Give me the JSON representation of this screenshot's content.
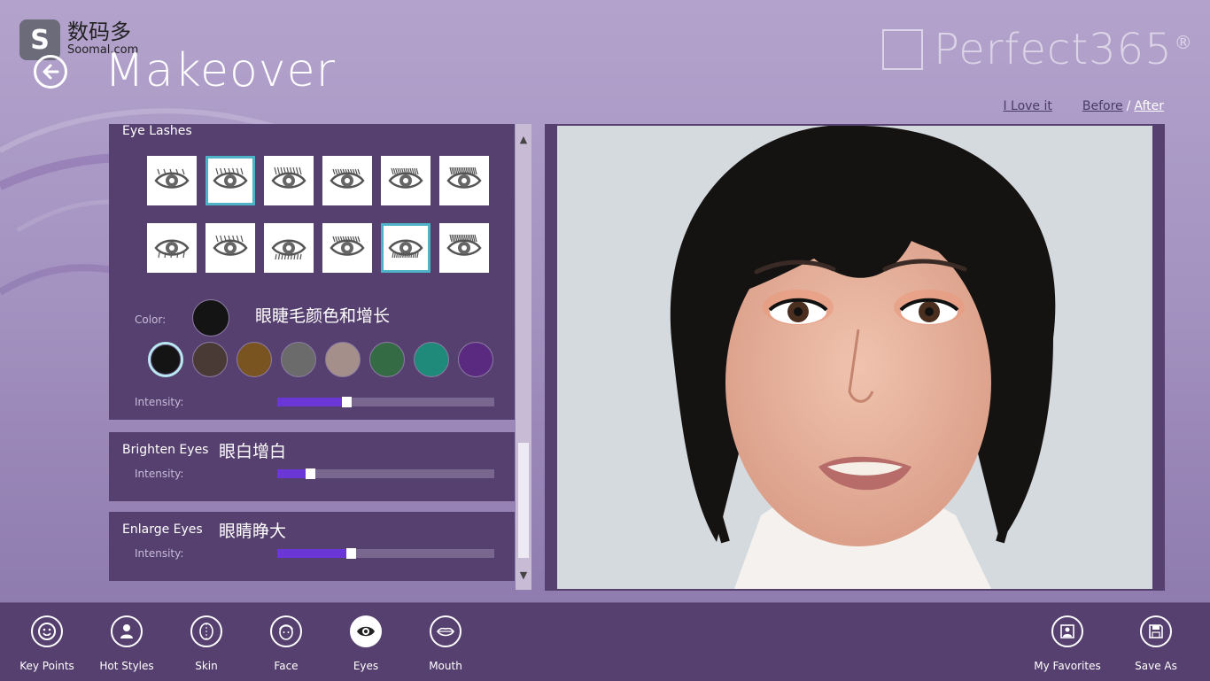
{
  "watermark": {
    "logo": "S",
    "cn": "数码多",
    "en": "Soomal.com"
  },
  "header": {
    "title": "Makeover",
    "brand": "Perfect365",
    "brand_mark": "®"
  },
  "top_links": {
    "love": "I Love it",
    "before": "Before",
    "separator": "/",
    "after": "After"
  },
  "eye_lashes": {
    "title": "Eye Lashes",
    "styles_count": 12,
    "selected_styles": [
      1,
      10
    ],
    "color_label": "Color:",
    "annotation": "眼睫毛颜色和增长",
    "current_color": "#141414",
    "swatches": [
      "#141414",
      "#4a3a36",
      "#7a5420",
      "#6b6b6b",
      "#a58f8a",
      "#356b44",
      "#1f8a7a",
      "#5a2a80"
    ],
    "selected_swatch": 0,
    "intensity_label": "Intensity:",
    "intensity": 0.32
  },
  "brighten_eyes": {
    "title": "Brighten Eyes",
    "annotation": "眼白增白",
    "intensity_label": "Intensity:",
    "intensity": 0.15
  },
  "enlarge_eyes": {
    "title": "Enlarge Eyes",
    "annotation": "眼睛睁大",
    "intensity_label": "Intensity:",
    "intensity": 0.34
  },
  "toolbar": {
    "items": [
      {
        "label": "Key Points",
        "icon": "smiley-icon"
      },
      {
        "label": "Hot Styles",
        "icon": "person-icon"
      },
      {
        "label": "Skin",
        "icon": "face-outline-icon"
      },
      {
        "label": "Face",
        "icon": "face-icon"
      },
      {
        "label": "Eyes",
        "icon": "eye-icon"
      },
      {
        "label": "Mouth",
        "icon": "lips-icon"
      }
    ],
    "active": "Eyes",
    "right_items": [
      {
        "label": "My Favorites",
        "icon": "favorites-icon"
      },
      {
        "label": "Save As",
        "icon": "save-icon"
      }
    ]
  }
}
